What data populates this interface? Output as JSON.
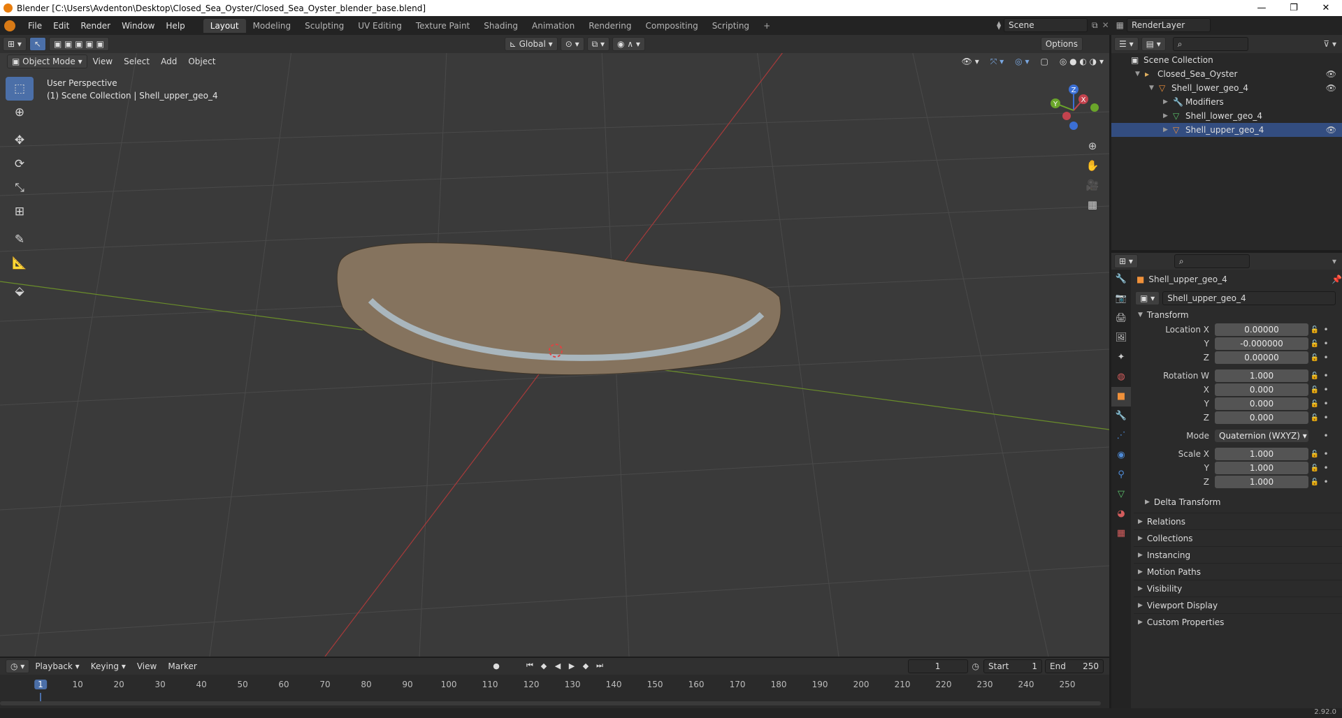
{
  "window": {
    "title": "Blender [C:\\Users\\Avdenton\\Desktop\\Closed_Sea_Oyster/Closed_Sea_Oyster_blender_base.blend]",
    "minimize": "—",
    "maximize": "❐",
    "close": "✕"
  },
  "menubar": {
    "items": [
      "File",
      "Edit",
      "Render",
      "Window",
      "Help"
    ]
  },
  "workspaces": {
    "tabs": [
      "Layout",
      "Modeling",
      "Sculpting",
      "UV Editing",
      "Texture Paint",
      "Shading",
      "Animation",
      "Rendering",
      "Compositing",
      "Scripting"
    ],
    "active": "Layout",
    "add": "+"
  },
  "scene": {
    "name": "Scene",
    "view_layer": "RenderLayer"
  },
  "viewport": {
    "mode": "Object Mode",
    "menus": [
      "View",
      "Select",
      "Add",
      "Object"
    ],
    "orientation": "Global",
    "options": "Options",
    "perspective": "User Perspective",
    "collection_info": "(1) Scene Collection | Shell_upper_geo_4",
    "gizmo": {
      "x": "X",
      "y": "Y",
      "z": "Z"
    }
  },
  "outliner": {
    "rows": [
      {
        "label": "Scene Collection",
        "indent": 0
      },
      {
        "label": "Closed_Sea_Oyster",
        "indent": 1
      },
      {
        "label": "Shell_lower_geo_4",
        "indent": 2
      },
      {
        "label": "Modifiers",
        "indent": 3
      },
      {
        "label": "Shell_lower_geo_4",
        "indent": 3
      },
      {
        "label": "Shell_upper_geo_4",
        "indent": 3
      }
    ]
  },
  "properties": {
    "object_name": "Shell_upper_geo_4",
    "data_name": "Shell_upper_geo_4",
    "transform_label": "Transform",
    "location": {
      "label_x": "Location X",
      "label_y": "Y",
      "label_z": "Z",
      "x": "0.00000",
      "y": "-0.000000",
      "z": "0.00000"
    },
    "rotation": {
      "label_w": "Rotation W",
      "label_x": "X",
      "label_y": "Y",
      "label_z": "Z",
      "w": "1.000",
      "x": "0.000",
      "y": "0.000",
      "z": "0.000"
    },
    "mode": {
      "label": "Mode",
      "value": "Quaternion (WXYZ)"
    },
    "scale": {
      "label_x": "Scale X",
      "label_y": "Y",
      "label_z": "Z",
      "x": "1.000",
      "y": "1.000",
      "z": "1.000"
    },
    "delta": "Delta Transform",
    "panels": [
      "Relations",
      "Collections",
      "Instancing",
      "Motion Paths",
      "Visibility",
      "Viewport Display",
      "Custom Properties"
    ]
  },
  "timeline": {
    "menus": [
      "Playback",
      "Keying",
      "View",
      "Marker"
    ],
    "current_frame": "1",
    "start_label": "Start",
    "start": "1",
    "end_label": "End",
    "end": "250",
    "ticks": [
      "1",
      "10",
      "20",
      "30",
      "40",
      "50",
      "60",
      "70",
      "80",
      "90",
      "100",
      "110",
      "120",
      "130",
      "140",
      "150",
      "160",
      "170",
      "180",
      "190",
      "200",
      "210",
      "220",
      "230",
      "240",
      "250"
    ]
  },
  "status": {
    "version": "2.92.0"
  }
}
